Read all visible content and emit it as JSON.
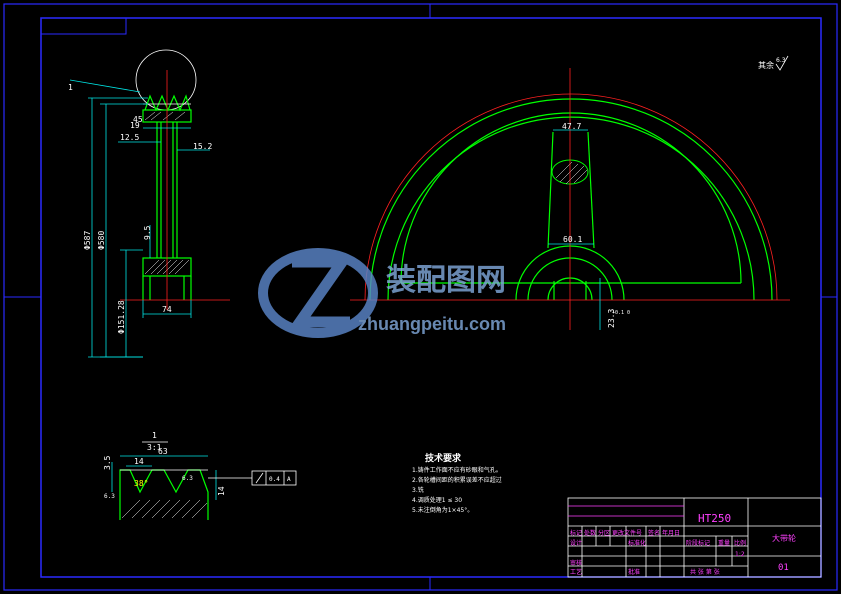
{
  "side_view": {
    "leader_label": "1",
    "dims": {
      "top_small": "45",
      "width_19": "19",
      "width_12_5": "12.5",
      "width_15_2": "15.2",
      "dim_9_5": "9.5",
      "bottom_width": "74",
      "dia_587": "Φ587",
      "dia_580": "Φ580",
      "dia_151_28": "Φ151.28"
    }
  },
  "front_view": {
    "dims": {
      "spoke_top": "47.7",
      "spoke_bottom": "60.1",
      "hub_key": "23.3",
      "hub_key_tol": "+0.1 0"
    }
  },
  "surface_note": "其余",
  "surface_value": "6.3",
  "detail": {
    "scale_num": "1",
    "scale_den": "3:1",
    "pitch_63": "63",
    "dim_3_5": "3.5",
    "dim_14": "14",
    "angle_38": "38°",
    "dim_14_right": "14",
    "tolerance_value": "0.4",
    "tolerance_datum": "A",
    "roughness_left": "6.3",
    "roughness_right": "6.3"
  },
  "tech_requirements": {
    "title": "技术要求",
    "lines": [
      "1.铸件工作面不应有砂眼和气孔。",
      "2.各轮槽间距的积累误差不应超过",
      "3.铣",
      "4.调质处理1  ≤ 30",
      "5.未注倒角为1×45°。"
    ]
  },
  "title_block": {
    "material": "HT250",
    "part_name": "大带轮",
    "code": "01",
    "labels": {
      "mark": "标记",
      "count": "处数",
      "zone": "分区",
      "change_doc": "更改文件号",
      "sign": "签名",
      "date": "年月日",
      "designer": "设计",
      "std": "标准化",
      "stage_mark": "阶段标记",
      "weight": "重量",
      "scale": "比例",
      "scale_val": "1:2",
      "checker": "审核",
      "craft": "工艺",
      "approve": "批准",
      "sheets": "共  张  第  张"
    }
  },
  "watermark": {
    "cn": "装配图网",
    "en": "zhuangpeitu.com"
  }
}
